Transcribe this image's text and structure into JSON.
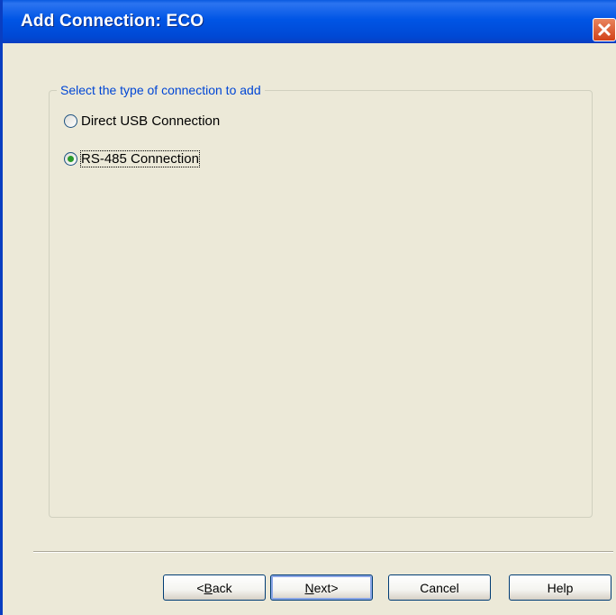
{
  "window": {
    "title": "Add Connection: ECO"
  },
  "group": {
    "legend": "Select the type of connection to add"
  },
  "options": [
    {
      "label": "Direct USB Connection",
      "selected": false
    },
    {
      "label": "RS-485 Connection",
      "selected": true
    }
  ],
  "buttons": {
    "back": {
      "mnemonic": "B",
      "rest": "ack",
      "prefix": "< "
    },
    "next": {
      "mnemonic": "N",
      "rest": "ext",
      "suffix": " >"
    },
    "cancel": "Cancel",
    "help": "Help"
  },
  "colors": {
    "titlebar": "#0055E5",
    "dialog_bg": "#ECE9D8",
    "legend_text": "#0046D5",
    "radio_dot": "#2A9A2A",
    "close_button": "#D2421A"
  }
}
